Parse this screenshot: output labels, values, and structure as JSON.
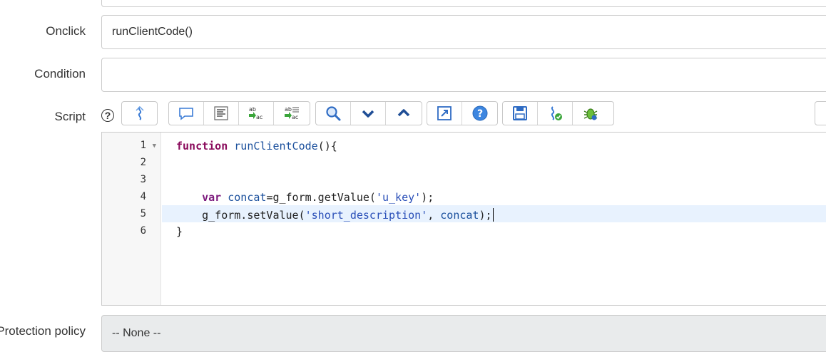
{
  "fields": {
    "onclick": {
      "label": "Onclick",
      "value": "runClientCode()"
    },
    "condition": {
      "label": "Condition",
      "value": ""
    },
    "script": {
      "label": "Script"
    },
    "protection_policy": {
      "label": "Protection policy",
      "value": "-- None --"
    }
  },
  "toolbar": {
    "help_icon": "?",
    "groups": [
      [
        "script-format-icon"
      ],
      [
        "comment-icon",
        "format-code-icon",
        "replace-icon",
        "replace-all-icon"
      ],
      [
        "search-icon",
        "next-match-icon",
        "previous-match-icon"
      ],
      [
        "fullscreen-icon",
        "help-icon"
      ],
      [
        "save-icon",
        "check-syntax-icon",
        "debug-icon"
      ]
    ]
  },
  "editor": {
    "line_numbers": [
      "1",
      "2",
      "3",
      "4",
      "5",
      "6"
    ],
    "lines": [
      {
        "kw": "function",
        "fn": "runClientCode",
        "rest": "(){"
      },
      {
        "text": ""
      },
      {
        "text": ""
      },
      {
        "indent": "    ",
        "kw": "var",
        "var": "concat",
        "pre": "=g_form.getValue(",
        "str": "'u_key'",
        "post": ");"
      },
      {
        "indent": "    ",
        "pre": "g_form.setValue(",
        "str": "'short_description'",
        "mid": ", ",
        "var": "concat",
        "post": ");"
      },
      {
        "text": "}"
      }
    ],
    "active_line": 5
  }
}
